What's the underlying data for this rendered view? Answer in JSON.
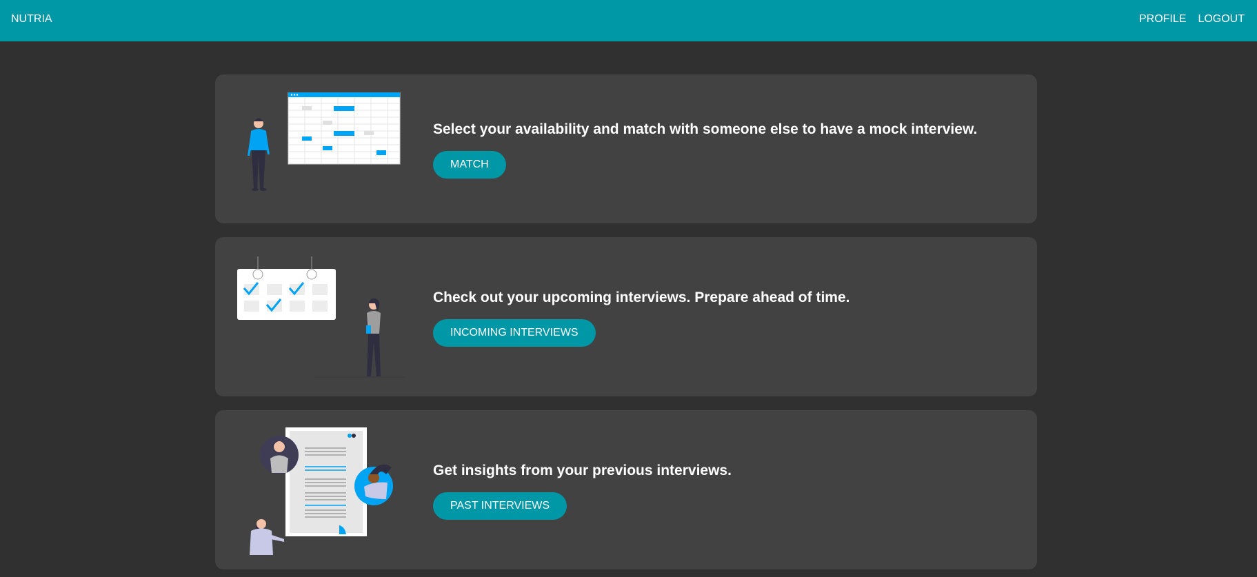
{
  "navbar": {
    "brand": "NUTRIA",
    "links": [
      "PROFILE",
      "LOGOUT"
    ]
  },
  "cards": [
    {
      "text": "Select your availability and match with someone else to have a mock interview.",
      "button": "MATCH",
      "illustration": "calendar-schedule-illustration"
    },
    {
      "text": "Check out your upcoming interviews. Prepare ahead of time.",
      "button": "INCOMING INTERVIEWS",
      "illustration": "checklist-calendar-illustration"
    },
    {
      "text": "Get insights from your previous interviews.",
      "button": "PAST INTERVIEWS",
      "illustration": "document-review-illustration"
    }
  ],
  "colors": {
    "accent": "#0097a7",
    "background": "#303030",
    "card": "#424242",
    "illustration_blue": "#00a4f2"
  }
}
